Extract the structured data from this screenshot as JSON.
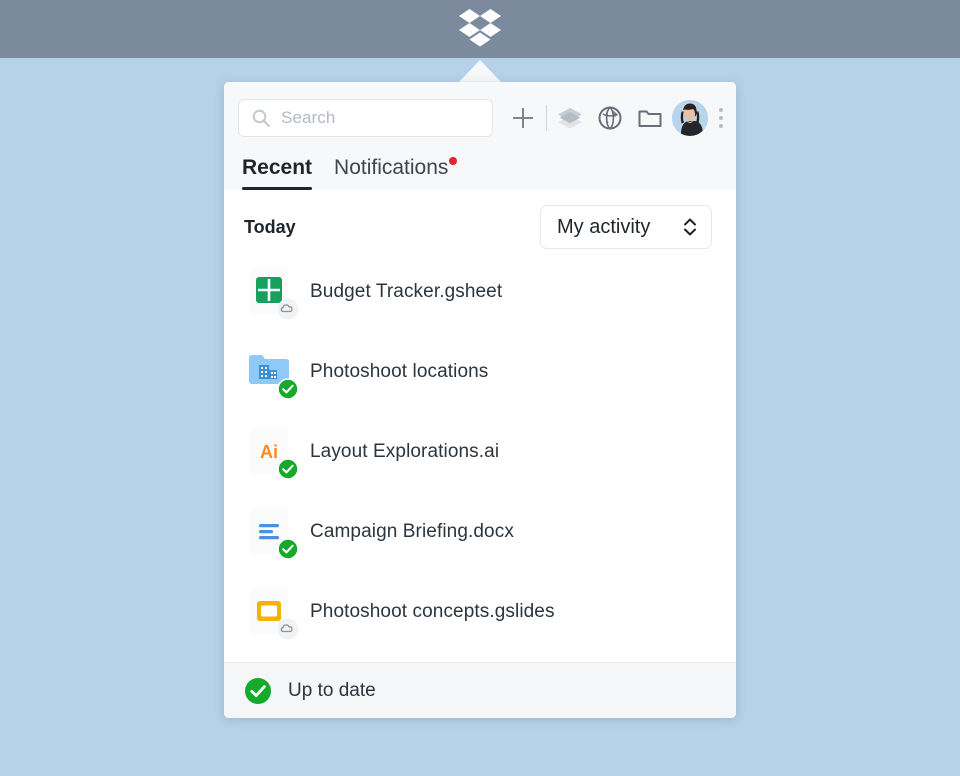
{
  "desktop": {
    "wallpaper_color": "#b6d2ea",
    "menubar_color": "#7c8a9d",
    "logo_name": "dropbox-logo"
  },
  "panel": {
    "search": {
      "placeholder": "Search",
      "value": "",
      "icon": "search-icon"
    },
    "actions": [
      {
        "name": "create-new-button",
        "icon": "plus-icon"
      },
      {
        "name": "divider",
        "icon": "vertical-divider"
      },
      {
        "name": "dropbox-paper-button",
        "icon": "layers-icon"
      },
      {
        "name": "dropbox-web-button",
        "icon": "globe-icon"
      },
      {
        "name": "open-folder-button",
        "icon": "folder-icon"
      },
      {
        "name": "account-avatar",
        "icon": "avatar-icon"
      },
      {
        "name": "more-menu-button",
        "icon": "kebab-menu-icon"
      }
    ],
    "tabs": [
      {
        "label": "Recent",
        "active": true,
        "badge": false
      },
      {
        "label": "Notifications",
        "active": false,
        "badge": true
      }
    ],
    "badge_color": "#e1262c",
    "section": {
      "title": "Today",
      "filter": {
        "label": "My activity",
        "icon": "chevron-updown-icon"
      }
    },
    "files": [
      {
        "name": "Budget Tracker.gsheet",
        "icon": "gsheet-icon",
        "icon_color": "#16a05d",
        "status": "cloud",
        "status_icon": "cloud-icon"
      },
      {
        "name": "Photoshoot locations",
        "icon": "team-folder-icon",
        "icon_color": "#86c5f5",
        "status": "synced",
        "status_icon": "check-circle-icon"
      },
      {
        "name": "Layout Explorations.ai",
        "icon": "illustrator-icon",
        "icon_label": "Ai",
        "icon_color": "#f28c28",
        "status": "synced",
        "status_icon": "check-circle-icon"
      },
      {
        "name": "Campaign Briefing.docx",
        "icon": "docx-icon",
        "icon_color": "#4a90e2",
        "status": "synced",
        "status_icon": "check-circle-icon"
      },
      {
        "name": "Photoshoot concepts.gslides",
        "icon": "gslides-icon",
        "icon_color": "#f5b301",
        "status": "cloud",
        "status_icon": "cloud-icon"
      }
    ],
    "footer": {
      "status_text": "Up to date",
      "status_icon": "check-circle-icon",
      "status_color": "#15aa2c"
    }
  }
}
